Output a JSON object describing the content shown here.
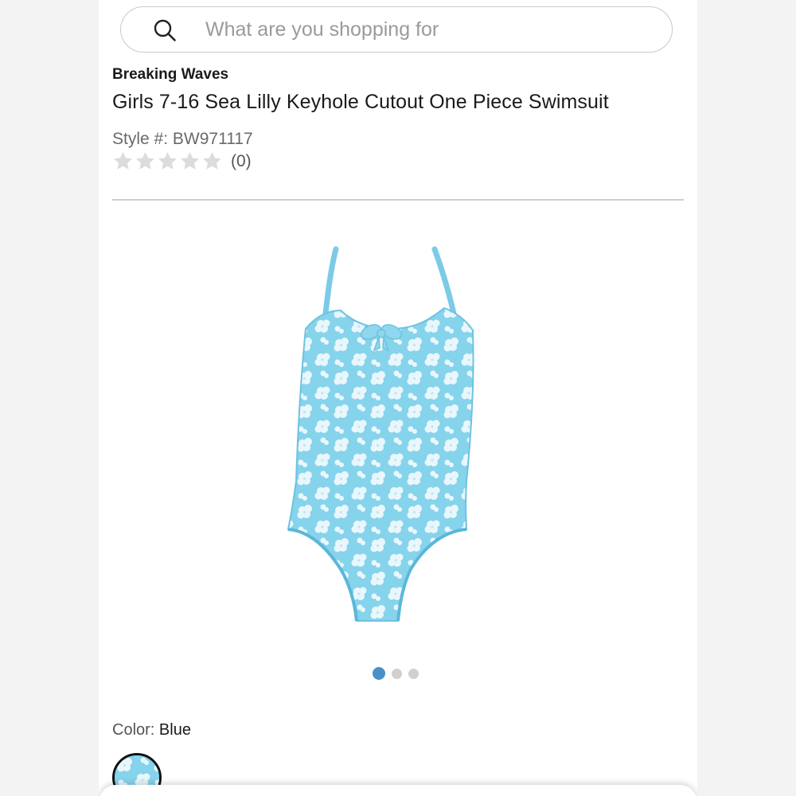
{
  "search": {
    "placeholder": "What are you shopping for",
    "icon": "search-icon"
  },
  "product": {
    "brand": "Breaking Waves",
    "title": "Girls 7-16 Sea Lilly Keyhole Cutout One Piece Swimsuit",
    "style_label": "Style #:",
    "style_number": "BW971117",
    "rating": {
      "stars_total": 5,
      "stars_filled": 0,
      "count_text": "(0)"
    }
  },
  "gallery": {
    "image_description_icon": "swimsuit-image",
    "dots": [
      {
        "active": true
      },
      {
        "active": false
      },
      {
        "active": false
      }
    ]
  },
  "color": {
    "label": "Color:",
    "value": "Blue",
    "swatch_color": "#7fd0e8"
  },
  "colors": {
    "swimsuit_base": "#86d3ec",
    "flower": "#e9f7fc",
    "active_dot": "#4a90c8",
    "inactive_dot": "#d0d0d0",
    "star_empty": "#dcdcdc"
  }
}
